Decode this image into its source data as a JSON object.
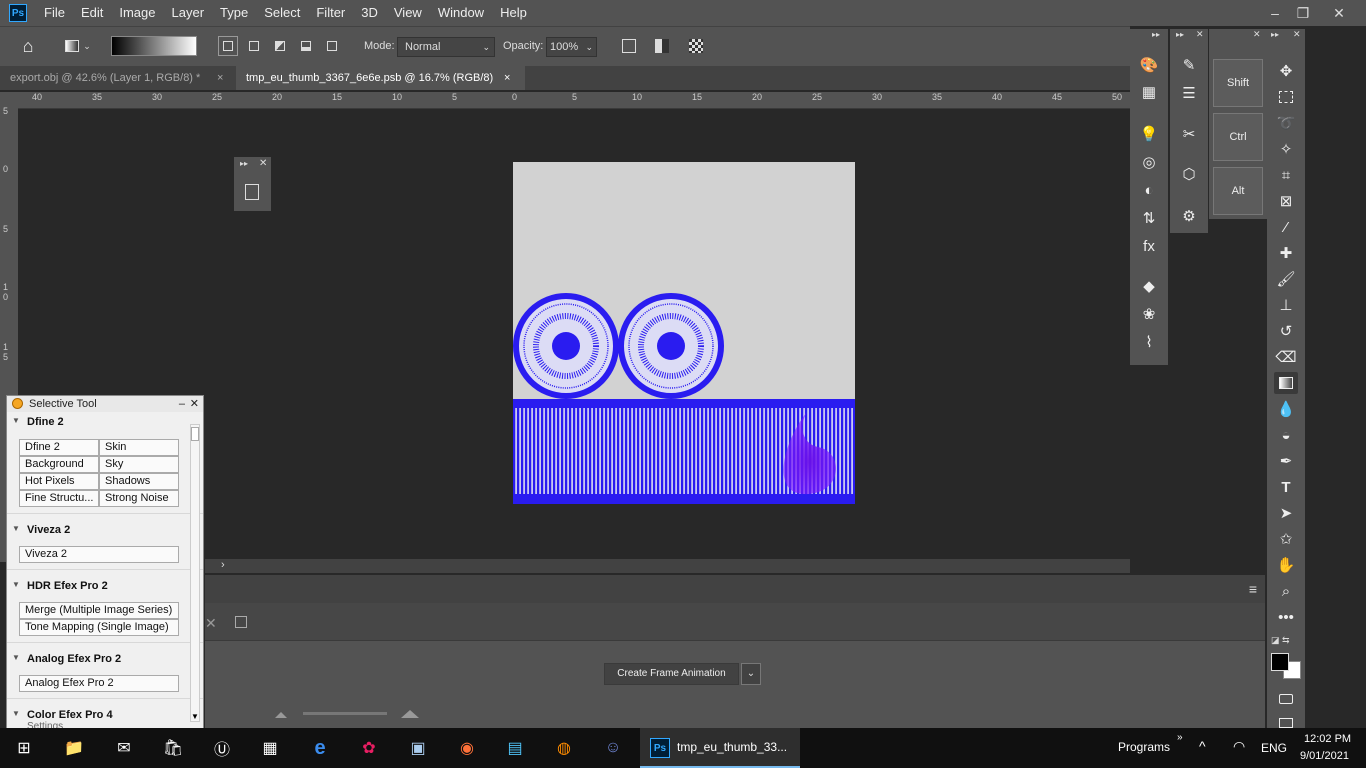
{
  "menu": [
    "File",
    "Edit",
    "Image",
    "Layer",
    "Type",
    "Select",
    "Filter",
    "3D",
    "View",
    "Window",
    "Help"
  ],
  "options": {
    "mode_label": "Mode:",
    "mode_value": "Normal",
    "opacity_label": "Opacity:",
    "opacity_value": "100%"
  },
  "tabs": [
    {
      "label": "export.obj @ 42.6% (Layer 1, RGB/8) *"
    },
    {
      "label": "tmp_eu_thumb_3367_6e6e.psb @ 16.7% (RGB/8)"
    }
  ],
  "ruler_top": [
    "40",
    "35",
    "30",
    "25",
    "20",
    "15",
    "10",
    "5",
    "0",
    "5",
    "10",
    "15",
    "20",
    "25",
    "30",
    "35",
    "40",
    "45",
    "50"
  ],
  "ruler_left": [
    "5",
    "0",
    "5",
    "1",
    "0",
    "1",
    "5"
  ],
  "selective": {
    "title": "Selective Tool",
    "groups": [
      {
        "name": "Dfine 2",
        "buttons": [
          [
            "Dfine 2",
            "Skin"
          ],
          [
            "Background",
            "Sky"
          ],
          [
            "Hot Pixels",
            "Shadows"
          ],
          [
            "Fine Structu...",
            "Strong Noise"
          ]
        ]
      },
      {
        "name": "Viveza 2",
        "buttons": [
          [
            "Viveza 2"
          ]
        ]
      },
      {
        "name": "HDR Efex Pro 2",
        "buttons": [
          [
            "Merge (Multiple Image Series)"
          ],
          [
            "Tone Mapping (Single Image)"
          ]
        ]
      },
      {
        "name": "Analog Efex Pro 2",
        "buttons": [
          [
            "Analog Efex Pro 2"
          ]
        ]
      },
      {
        "name": "Color Efex Pro 4",
        "buttons": []
      }
    ],
    "footer": "Settings"
  },
  "keys": [
    "Shift",
    "Ctrl",
    "Alt"
  ],
  "timeline": {
    "create_button": "Create Frame Animation"
  },
  "taskbar": {
    "active_app": "tmp_eu_thumb_33...",
    "programs": "Programs",
    "lang": "ENG",
    "time": "12:02 PM",
    "date": "9/01/2021"
  },
  "colors": {
    "accent": "#31a8ff",
    "blue_art": "#2a1cf0"
  }
}
